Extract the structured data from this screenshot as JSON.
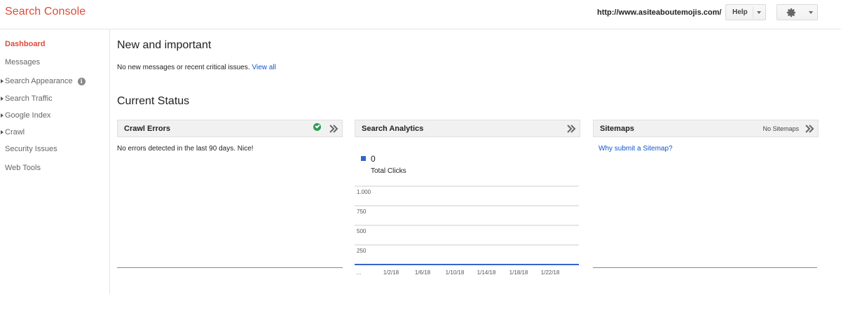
{
  "header": {
    "brand": "Search Console",
    "site_url": "http://www.asiteaboutemojis.com/",
    "help_label": "Help"
  },
  "sidebar": {
    "items": [
      {
        "label": "Dashboard",
        "active": true,
        "expandable": false
      },
      {
        "label": "Messages",
        "active": false,
        "expandable": false
      },
      {
        "label": "Search Appearance",
        "active": false,
        "expandable": true,
        "info": true
      },
      {
        "label": "Search Traffic",
        "active": false,
        "expandable": true
      },
      {
        "label": "Google Index",
        "active": false,
        "expandable": true
      },
      {
        "label": "Crawl",
        "active": false,
        "expandable": true
      },
      {
        "label": "Security Issues",
        "active": false,
        "expandable": false
      },
      {
        "label": "Web Tools",
        "active": false,
        "expandable": false
      }
    ]
  },
  "main": {
    "new_heading": "New and important",
    "notice_text": "No new messages or recent critical issues.",
    "notice_link": "View all",
    "status_heading": "Current Status",
    "cards": {
      "crawl_errors": {
        "title": "Crawl Errors",
        "body": "No errors detected in the last 90 days. Nice!"
      },
      "search_analytics": {
        "title": "Search Analytics",
        "legend_value": "0",
        "legend_label": "Total Clicks"
      },
      "sitemaps": {
        "title": "Sitemaps",
        "meta": "No Sitemaps",
        "link": "Why submit a Sitemap?"
      }
    }
  },
  "colors": {
    "brand": "#dd4b39",
    "link": "#1155cc",
    "series": "#3366cc",
    "ok": "#2e9b54"
  },
  "chart_data": {
    "type": "line",
    "series": [
      {
        "name": "Total Clicks",
        "values": [
          0,
          0,
          0,
          0,
          0,
          0,
          0,
          0
        ]
      }
    ],
    "x": [
      "...",
      "1/2/18",
      "1/6/18",
      "1/10/18",
      "1/14/18",
      "1/18/18",
      "1/22/18",
      ""
    ],
    "ytick_labels": [
      "1.000",
      "750",
      "500",
      "250"
    ],
    "yticks": [
      1000,
      750,
      500,
      250
    ],
    "ylim": [
      0,
      1000
    ],
    "grid": true
  }
}
